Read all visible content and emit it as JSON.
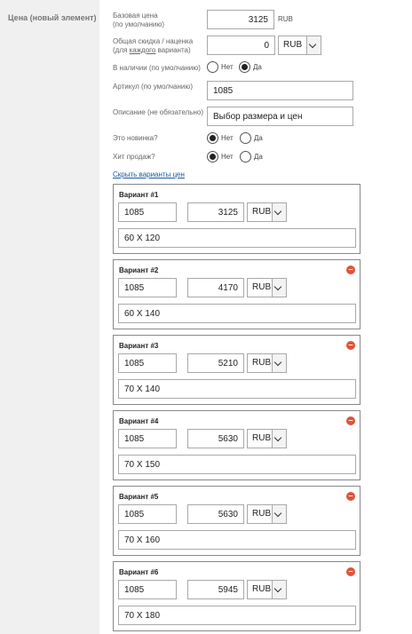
{
  "sidebar": {
    "title": "Цена (новый элемент)"
  },
  "form": {
    "base_price": {
      "label_line1": "Базовая цена",
      "label_line2": "(по умолчанию)",
      "value": "3125",
      "unit": "RUB"
    },
    "discount": {
      "label_line1": "Общая скидка / наценка",
      "label_line2_pre": "(для ",
      "label_line2_u": "каждого",
      "label_line2_post": " варианта)",
      "value": "0",
      "currency": "RUB"
    },
    "in_stock": {
      "label": "В наличии (по умолчанию)",
      "no": "Нет",
      "yes": "Да",
      "selected": "yes"
    },
    "sku": {
      "label": "Артикул (по умолчанию)",
      "value": "1085"
    },
    "description": {
      "label": "Описание (не обязательно)",
      "value": "Выбор размера и цен"
    },
    "is_new": {
      "label": "Это новинка?",
      "no": "Нет",
      "yes": "Да",
      "selected": "no"
    },
    "is_hit": {
      "label": "Хит продаж?",
      "no": "Нет",
      "yes": "Да",
      "selected": "no"
    },
    "toggle_variants": "Скрыть варианты цен"
  },
  "variants": [
    {
      "title": "Вариант #1",
      "sku": "1085",
      "price": "3125",
      "currency": "RUB",
      "description": "60 X 120",
      "removable": false
    },
    {
      "title": "Вариант #2",
      "sku": "1085",
      "price": "4170",
      "currency": "RUB",
      "description": "60 X 140",
      "removable": true
    },
    {
      "title": "Вариант #3",
      "sku": "1085",
      "price": "5210",
      "currency": "RUB",
      "description": "70 X 140",
      "removable": true
    },
    {
      "title": "Вариант #4",
      "sku": "1085",
      "price": "5630",
      "currency": "RUB",
      "description": "70 X 150",
      "removable": true
    },
    {
      "title": "Вариант #5",
      "sku": "1085",
      "price": "5630",
      "currency": "RUB",
      "description": "70 X 160",
      "removable": true
    },
    {
      "title": "Вариант #6",
      "sku": "1085",
      "price": "5945",
      "currency": "RUB",
      "description": "70 X 180",
      "removable": true
    }
  ],
  "icons": {
    "remove": "remove-circle-icon",
    "dropdown": "chevron-down-icon"
  },
  "colors": {
    "remove": "#e0533a",
    "link": "#1a5aa0",
    "sidebar": "#f0f0f0"
  }
}
